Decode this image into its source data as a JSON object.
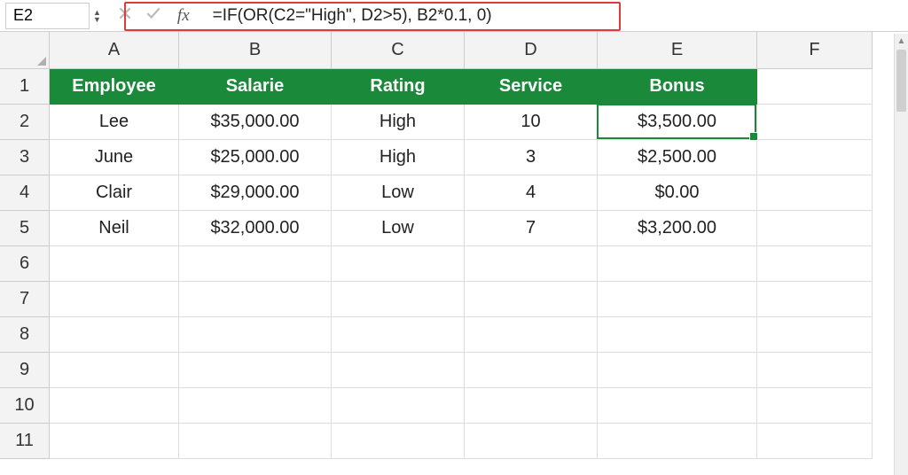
{
  "formula_bar": {
    "cell_ref": "E2",
    "fx_label": "fx",
    "formula": "=IF(OR(C2=\"High\", D2>5), B2*0.1, 0)"
  },
  "columns": [
    {
      "letter": "A",
      "width_class": "col-A"
    },
    {
      "letter": "B",
      "width_class": "col-B"
    },
    {
      "letter": "C",
      "width_class": "col-C"
    },
    {
      "letter": "D",
      "width_class": "col-D"
    },
    {
      "letter": "E",
      "width_class": "col-E"
    },
    {
      "letter": "F",
      "width_class": "col-F"
    }
  ],
  "row_numbers": [
    "1",
    "2",
    "3",
    "4",
    "5",
    "6",
    "7",
    "8",
    "9",
    "10",
    "11"
  ],
  "headers": {
    "A": "Employee",
    "B": "Salarie",
    "C": "Rating",
    "D": "Service",
    "E": "Bonus"
  },
  "rows": [
    {
      "A": "Lee",
      "B": "$35,000.00",
      "C": "High",
      "D": "10",
      "E": "$3,500.00"
    },
    {
      "A": "June",
      "B": "$25,000.00",
      "C": "High",
      "D": "3",
      "E": "$2,500.00"
    },
    {
      "A": "Clair",
      "B": "$29,000.00",
      "C": "Low",
      "D": "4",
      "E": "$0.00"
    },
    {
      "A": "Neil",
      "B": "$32,000.00",
      "C": "Low",
      "D": "7",
      "E": "$3,200.00"
    }
  ],
  "selected_cell": "E2",
  "colors": {
    "header_bg": "#1a8a3a",
    "highlight_border": "#e03a3a"
  }
}
